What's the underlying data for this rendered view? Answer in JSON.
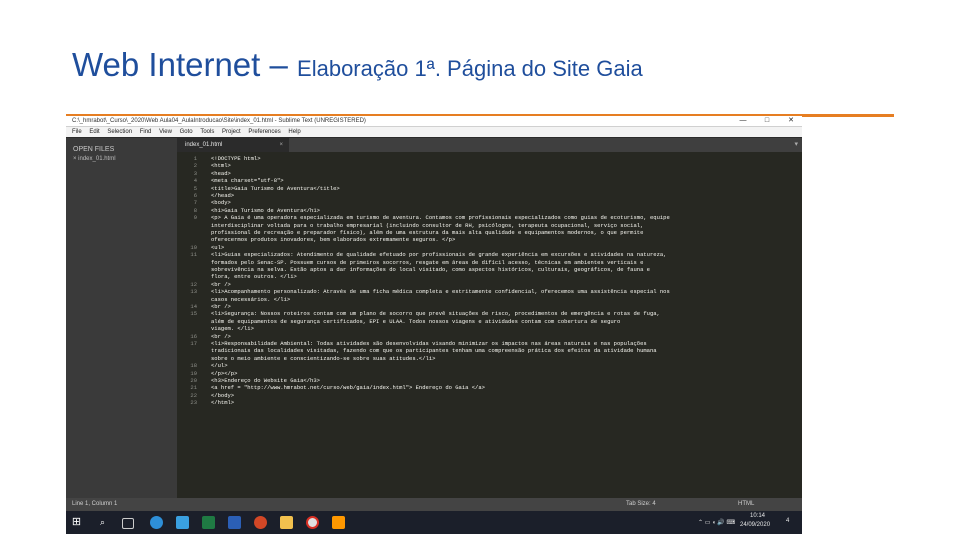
{
  "slide": {
    "title_main": "Web Internet – ",
    "title_sub": "Elaboração 1ª. Página do Site Gaia",
    "accent_color": "#e67e22",
    "title_color": "#1f4e9c"
  },
  "window": {
    "title": "C:\\_hmrabot\\_Curso\\_2020\\Web Aula04_AulaIntroducao\\Site\\index_01.html - Sublime Text (UNREGISTERED)",
    "controls": [
      "—",
      "□",
      "✕"
    ]
  },
  "menu": [
    "File",
    "Edit",
    "Selection",
    "Find",
    "View",
    "Goto",
    "Tools",
    "Project",
    "Preferences",
    "Help"
  ],
  "sidebar": {
    "header": "OPEN FILES",
    "file": "× index_01.html"
  },
  "tab": {
    "label": "index_01.html",
    "close": "×"
  },
  "code_lines": [
    {
      "n": "1",
      "t": "<!DOCTYPE html>"
    },
    {
      "n": "2",
      "t": "<html>"
    },
    {
      "n": "3",
      "t": "    <head>"
    },
    {
      "n": "4",
      "t": "        <meta charset=\"utf-8\">"
    },
    {
      "n": "5",
      "t": "        <title>Gaia Turismo de Aventura</title>"
    },
    {
      "n": "6",
      "t": "    </head>"
    },
    {
      "n": "7",
      "t": "<body>"
    },
    {
      "n": "8",
      "t": "    <h1>Gaia Turismo de Aventura</h1>"
    },
    {
      "n": "9",
      "t": "        <p> A Gaia é uma operadora especializada em turismo de aventura. Contamos com profissionais especializados como guias de ecoturismo, equipe"
    },
    {
      "n": "",
      "t": "        interdisciplinar voltada para o trabalho empresarial (incluindo consultor de RH, psicólogos, terapeuta ocupacional, serviço social,"
    },
    {
      "n": "",
      "t": "        profissional de recreação e preparador físico), além de uma estrutura da mais alta qualidade e equipamentos modernos, o que permite"
    },
    {
      "n": "",
      "t": "        oferecermos produtos inovadores, bem elaborados extremamente seguros. </p>"
    },
    {
      "n": "10",
      "t": "        <ul>"
    },
    {
      "n": "11",
      "t": "            <li>Guias especializados: Atendimento de qualidade efetuado por profissionais de grande experiência em excursões e atividades na natureza,"
    },
    {
      "n": "",
      "t": "            formados pelo Senac-SP. Possuem cursos de primeiros socorros, resgate em áreas de difícil acesso, técnicas em ambientes verticais e"
    },
    {
      "n": "",
      "t": "            sobrevivência na selva. Estão aptos a dar informações do local visitado, como aspectos históricos, culturais, geográficos, de fauna e"
    },
    {
      "n": "",
      "t": "            flora, entre outros. </li>"
    },
    {
      "n": "12",
      "t": "            <br />"
    },
    {
      "n": "13",
      "t": "            <li>Acompanhamento personalizado: Através de uma ficha médica completa e estritamente confidencial, oferecemos uma assistência especial nos"
    },
    {
      "n": "",
      "t": "            casos necessários. </li>"
    },
    {
      "n": "14",
      "t": "            <br />"
    },
    {
      "n": "15",
      "t": "            <li>Segurança: Nossos roteiros contam com um plano de socorro que prevê situações de risco, procedimentos de emergência e rotas de fuga,"
    },
    {
      "n": "",
      "t": "            além de equipamentos de segurança certificados, EPI e ULAA. Todos nossos viagens e atividades contam com cobertura de seguro"
    },
    {
      "n": "",
      "t": "            viagem. </li>"
    },
    {
      "n": "16",
      "t": "            <br />"
    },
    {
      "n": "17",
      "t": "            <li>Responsabilidade Ambiental: Todas atividades são desenvolvidas visando minimizar os impactos nas áreas naturais e nas populações"
    },
    {
      "n": "",
      "t": "            tradicionais das localidades visitadas, fazendo com que os participantes tenham uma compreensão prática dos efeitos da atividade humana"
    },
    {
      "n": "",
      "t": "            sobre o meio ambiente e conscientizando-se sobre suas atitudes.</li>"
    },
    {
      "n": "18",
      "t": "        </ul>"
    },
    {
      "n": "19",
      "t": "    </p></p>"
    },
    {
      "n": "20",
      "t": "    <h3>Endereço do Website Gaia</h3>"
    },
    {
      "n": "21",
      "t": "    <a href = \"http://www.hmrabot.net/curso/web/gaia/index.html\"> Endereço do Gaia </a>"
    },
    {
      "n": "22",
      "t": "</body>"
    },
    {
      "n": "23",
      "t": "</html>"
    }
  ],
  "status": {
    "left": "Line 1, Column 1",
    "tab_size": "Tab Size: 4",
    "syntax": "HTML"
  },
  "taskbar": {
    "time": "10:14",
    "date": "24/09/2020",
    "notification_count": "4",
    "apps": [
      "windows-logo",
      "search",
      "task-view",
      "edge",
      "chrome-browser",
      "excel",
      "word",
      "powerpoint",
      "file-explorer",
      "chrome",
      "sublime-text"
    ]
  }
}
